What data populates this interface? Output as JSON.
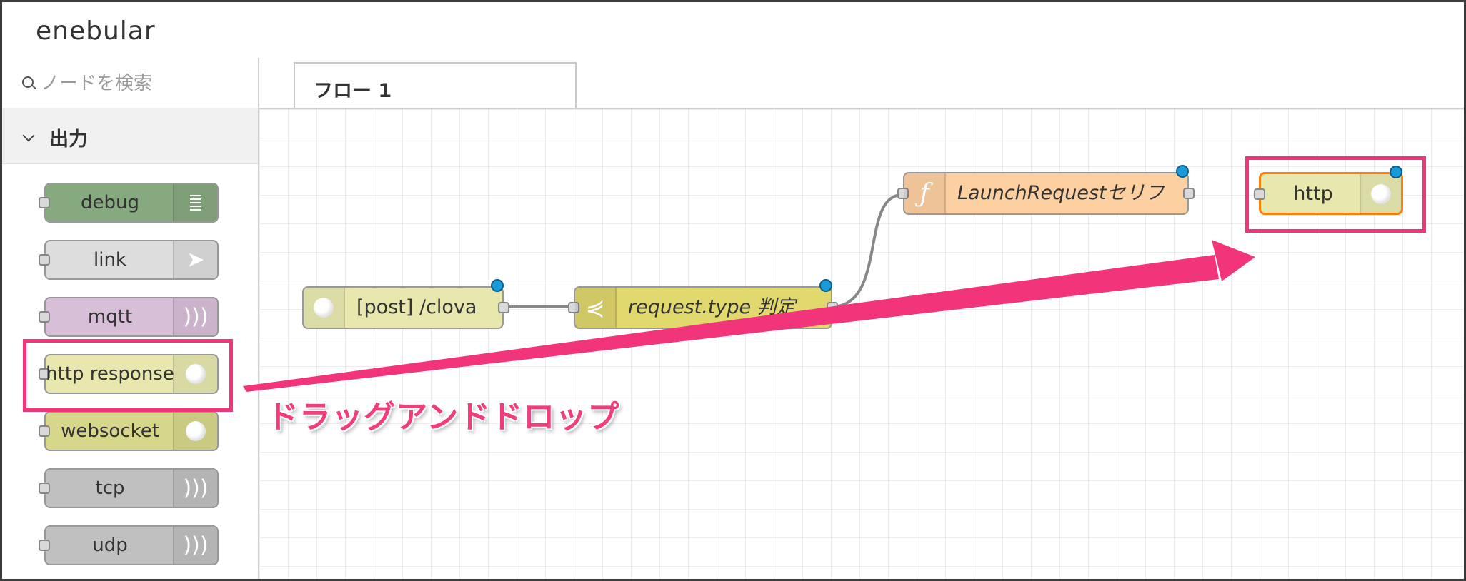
{
  "app": {
    "logo": "enebular"
  },
  "search": {
    "placeholder": "ノードを検索"
  },
  "palette": {
    "category": "出力",
    "nodes": [
      {
        "label": "debug",
        "color": "#87a980",
        "icon": "list-icon"
      },
      {
        "label": "link",
        "color": "#dddddd",
        "icon": "link-out-icon"
      },
      {
        "label": "mqtt",
        "color": "#d8bfd8",
        "icon": "bridge-icon"
      },
      {
        "label": "http response",
        "color": "#e7e7ae",
        "icon": "globe-icon"
      },
      {
        "label": "websocket",
        "color": "#d7d78c",
        "icon": "globe-icon"
      },
      {
        "label": "tcp",
        "color": "#c0c0c0",
        "icon": "bridge-icon"
      },
      {
        "label": "udp",
        "color": "#c0c0c0",
        "icon": "bridge-icon"
      }
    ]
  },
  "tabs": [
    {
      "label": "フロー 1"
    }
  ],
  "flow": {
    "nodes": [
      {
        "label": "[post] /clova",
        "color": "#e7e7ae",
        "icon": "globe-icon"
      },
      {
        "label": "request.type 判定",
        "color": "#e2d96e",
        "icon": "switch-icon"
      },
      {
        "label": "LaunchRequestセリフ",
        "color": "#fdd0a2",
        "icon": "function-icon"
      },
      {
        "label": "http",
        "color": "#e7e7ae",
        "icon": "globe-icon"
      }
    ]
  },
  "annotation": {
    "text": "ドラッグアンドドロップ",
    "color": "#f2357a"
  }
}
